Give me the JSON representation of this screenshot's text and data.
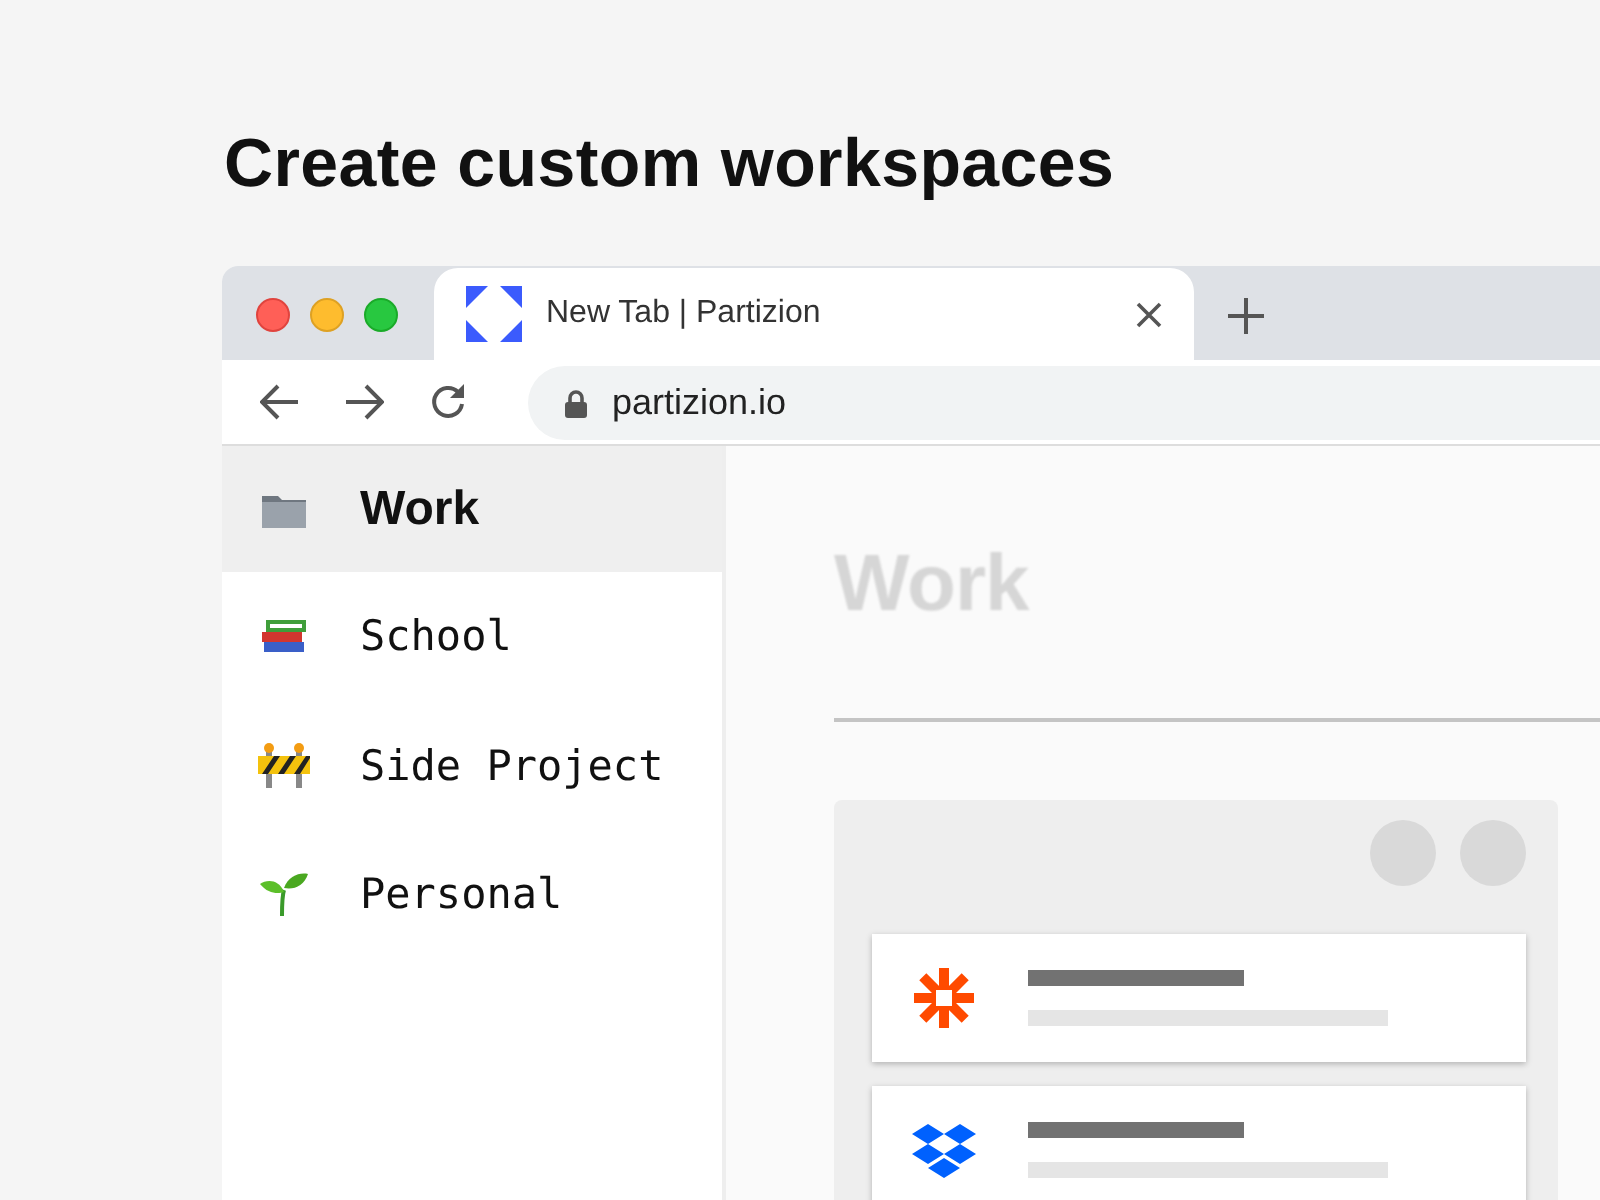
{
  "heading": "Create custom workspaces",
  "browser": {
    "tab": {
      "title": "New Tab | Partizion"
    },
    "address": {
      "url": "partizion.io"
    }
  },
  "sidebar": {
    "items": [
      {
        "label": "Work",
        "selected": true
      },
      {
        "label": "School",
        "selected": false
      },
      {
        "label": "Side Project",
        "selected": false
      },
      {
        "label": "Personal",
        "selected": false
      }
    ]
  },
  "main": {
    "title": "Work"
  }
}
